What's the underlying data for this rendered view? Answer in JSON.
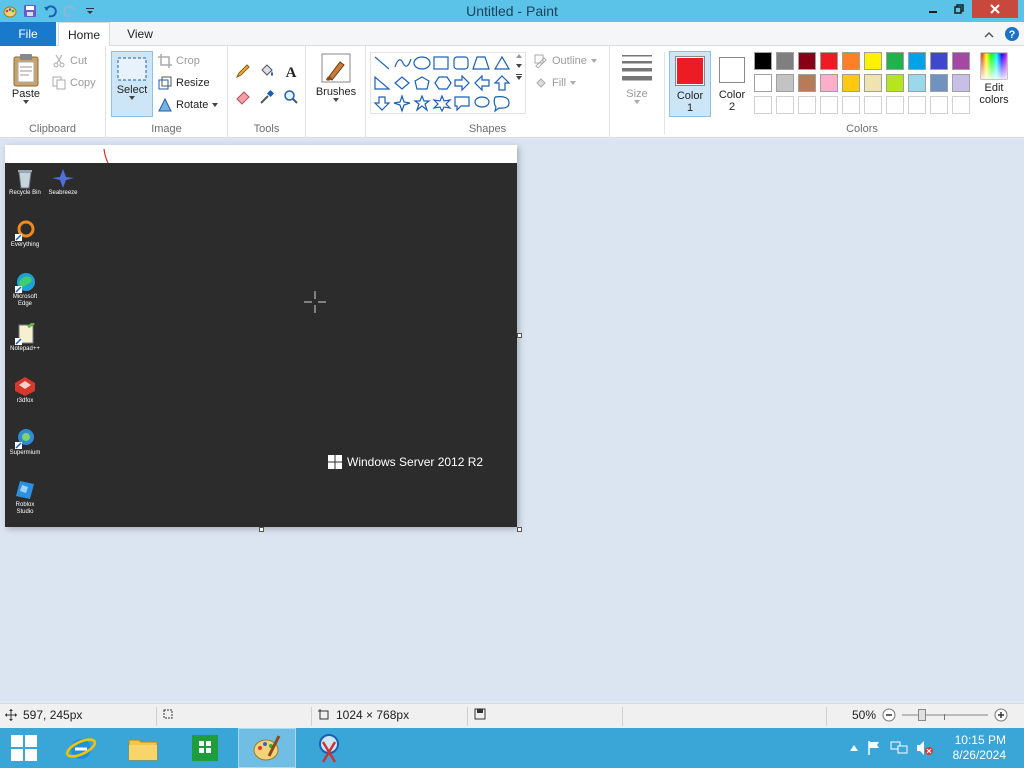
{
  "window": {
    "title": "Untitled - Paint"
  },
  "tabs": {
    "file": "File",
    "home": "Home",
    "view": "View"
  },
  "clipboard": {
    "paste": "Paste",
    "cut": "Cut",
    "copy": "Copy",
    "label": "Clipboard"
  },
  "image": {
    "select": "Select",
    "crop": "Crop",
    "resize": "Resize",
    "rotate": "Rotate",
    "label": "Image"
  },
  "tools": {
    "label": "Tools"
  },
  "brushes": {
    "label": "Brushes"
  },
  "shapes": {
    "outline": "Outline",
    "fill": "Fill",
    "label": "Shapes"
  },
  "size": {
    "label": "Size"
  },
  "color1": {
    "line1": "Color",
    "line2": "1",
    "value": "#ed1c24"
  },
  "color2": {
    "line1": "Color",
    "line2": "2",
    "value": "#ffffff"
  },
  "colors": {
    "label": "Colors",
    "edit_line1": "Edit",
    "edit_line2": "colors",
    "row1": [
      "#000000",
      "#7f7f7f",
      "#880015",
      "#ed1c24",
      "#ff7f27",
      "#fff200",
      "#22b14c",
      "#00a2e8",
      "#3f48cc",
      "#a349a4"
    ],
    "row2": [
      "#ffffff",
      "#c3c3c3",
      "#b97a57",
      "#ffaec9",
      "#ffc90e",
      "#efe4b0",
      "#b5e61d",
      "#99d9ea",
      "#7092be",
      "#c8bfe7"
    ],
    "row3": [
      "#ffffff",
      "#ffffff",
      "#ffffff",
      "#ffffff",
      "#ffffff",
      "#ffffff",
      "#ffffff",
      "#ffffff",
      "#ffffff",
      "#ffffff"
    ]
  },
  "desktop": {
    "icons": [
      {
        "label": "Recycle Bin",
        "icon": "recycle-bin-icon"
      },
      {
        "label": "Seabreeze",
        "icon": "app-icon"
      },
      {
        "label": "Everything",
        "icon": "everything-icon"
      },
      {
        "label": "Microsoft Edge",
        "icon": "edge-icon"
      },
      {
        "label": "Notepad++",
        "icon": "notepad-icon"
      },
      {
        "label": "r3dfox",
        "icon": "r3dfox-icon"
      },
      {
        "label": "Supermium",
        "icon": "supermium-icon"
      },
      {
        "label": "Roblox Studio",
        "icon": "roblox-studio-icon"
      }
    ],
    "brand": "Windows Server 2012 R2"
  },
  "status": {
    "cursor_pos": "597, 245px",
    "image_size": "1024 × 768px",
    "zoom": "50%"
  },
  "taskbar": {
    "time": "10:15 PM",
    "date": "8/26/2024"
  }
}
